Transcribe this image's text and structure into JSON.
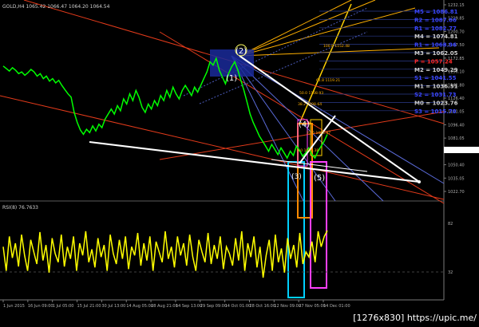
{
  "header": {
    "price_title": "GOLD,H4 1065.42 1066.47 1064.20 1064.54",
    "rsi_title": "RSI(8) 76.7633"
  },
  "watermark": "[1276x830] https://upic.me/",
  "colors": {
    "background": "#000000",
    "price_line": "#00ff00",
    "rsi_line": "#ffff00",
    "trend_white": "#ffffff",
    "channel_red": "#e23a1a",
    "fan_orange": "#ffb000",
    "fib_blue": "#5a6ad8",
    "level_blue": "#3a46ff",
    "level_red": "#ff2a2a",
    "level_gray": "#d0d0d0"
  },
  "chart_data": [
    {
      "type": "line",
      "panel": "price",
      "series": [
        {
          "name": "GOLD,H4",
          "values": [
            1175,
            1172,
            1169,
            1173,
            1170,
            1166,
            1168,
            1164,
            1167,
            1171,
            1168,
            1163,
            1166,
            1160,
            1163,
            1157,
            1160,
            1155,
            1158,
            1152,
            1147,
            1142,
            1138,
            1120,
            1108,
            1099,
            1094,
            1100,
            1096,
            1104,
            1098,
            1106,
            1102,
            1112,
            1118,
            1124,
            1118,
            1128,
            1122,
            1136,
            1130,
            1142,
            1134,
            1146,
            1138,
            1126,
            1120,
            1130,
            1124,
            1134,
            1128,
            1140,
            1134,
            1146,
            1138,
            1150,
            1142,
            1136,
            1146,
            1152,
            1146,
            1140,
            1150,
            1144,
            1152,
            1160,
            1168,
            1180,
            1176,
            1184,
            1170,
            1162,
            1154,
            1166,
            1174,
            1180,
            1170,
            1158,
            1146,
            1132,
            1118,
            1108,
            1100,
            1092,
            1086,
            1080,
            1074,
            1082,
            1076,
            1070,
            1078,
            1072,
            1066,
            1074,
            1069,
            1080,
            1075,
            1068,
            1072,
            1078,
            1070,
            1066,
            1074,
            1080,
            1086,
            1094
          ]
        }
      ],
      "x_tick_labels": [
        "1 Jun 2015",
        "16 Jun 09:00",
        "1 Jul 05:00",
        "15 Jul 21:00",
        "30 Jul 13:00",
        "14 Aug 05:00",
        "28 Aug 21:00",
        "14 Sep 13:00",
        "29 Sep 09:00",
        "14 Oct 01:00",
        "28 Oct 16:00",
        "12 Nov 09:00",
        "27 Nov 05:00",
        "14 Dec 01:00"
      ],
      "y_tick_labels": [
        "1232.15",
        "1219.85",
        "1200.70",
        "1187.50",
        "1172.85",
        "1156.10",
        "1141.80",
        "1126.40",
        "1111.05",
        "1096.40",
        "1081.05",
        "1066.34",
        "1050.40",
        "1035.05",
        "1022.70"
      ],
      "ylim": [
        1015,
        1240
      ],
      "wave_labels": [
        "(1)",
        "(2)",
        "(3)",
        "(4)",
        "(5)"
      ],
      "levels": [
        {
          "label": "M5 = 1086.81",
          "color": "#3a46ff"
        },
        {
          "label": "R2 = 1087.66",
          "color": "#3a46ff"
        },
        {
          "label": "R1 = 1082.77",
          "color": "#3a46ff"
        },
        {
          "label": "M4 = 1074.81",
          "color": "#d0d0d0"
        },
        {
          "label": "R1 = 1068.96",
          "color": "#3a46ff"
        },
        {
          "label": "M3 = 1062.05",
          "color": "#d0d0d0"
        },
        {
          "label": "P = 1057.24",
          "color": "#ff2a2a"
        },
        {
          "label": "M2 = 1049.29",
          "color": "#d0d0d0"
        },
        {
          "label": "S1 = 1041.55",
          "color": "#3a46ff"
        },
        {
          "label": "M1 = 1036.51",
          "color": "#d0d0d0"
        },
        {
          "label": "S2 = 1031.73",
          "color": "#3a46ff"
        },
        {
          "label": "M0 = 1023.76",
          "color": "#d0d0d0"
        },
        {
          "label": "S3 = 1015.70",
          "color": "#3a46ff"
        }
      ],
      "fib_labels": [
        "100.0 1152.48",
        "61.8 1119.21",
        "50.0 1108.93",
        "38.2 1098.64",
        "23.6 1085.97",
        "0.0 1065.38"
      ]
    },
    {
      "type": "line",
      "panel": "RSI",
      "series": [
        {
          "name": "RSI(8)",
          "values": [
            58,
            30,
            70,
            45,
            62,
            35,
            72,
            48,
            30,
            66,
            52,
            38,
            75,
            42,
            60,
            28,
            68,
            50,
            40,
            72,
            35,
            58,
            44,
            70,
            30,
            62,
            48,
            76,
            40,
            55,
            34,
            68,
            46,
            60,
            30,
            72,
            50,
            38,
            66,
            44,
            70,
            32,
            58,
            48,
            74,
            36,
            62,
            42,
            70,
            30,
            64,
            52,
            40,
            76,
            44,
            58,
            34,
            70,
            48,
            62,
            36,
            72,
            46,
            30,
            66,
            52,
            40,
            74,
            38,
            60,
            44,
            70,
            32,
            58,
            50,
            36,
            68,
            42,
            76,
            30,
            62,
            46,
            70,
            34,
            58,
            22,
            48,
            66,
            30,
            72,
            40,
            56,
            28,
            68,
            44,
            60,
            34,
            74,
            38,
            52,
            46,
            64,
            40,
            76,
            58,
            70,
            76.76
          ],
          "level": 32
        }
      ],
      "y_tick_labels": [
        "82",
        "32"
      ],
      "ylim": [
        0,
        100
      ]
    }
  ]
}
